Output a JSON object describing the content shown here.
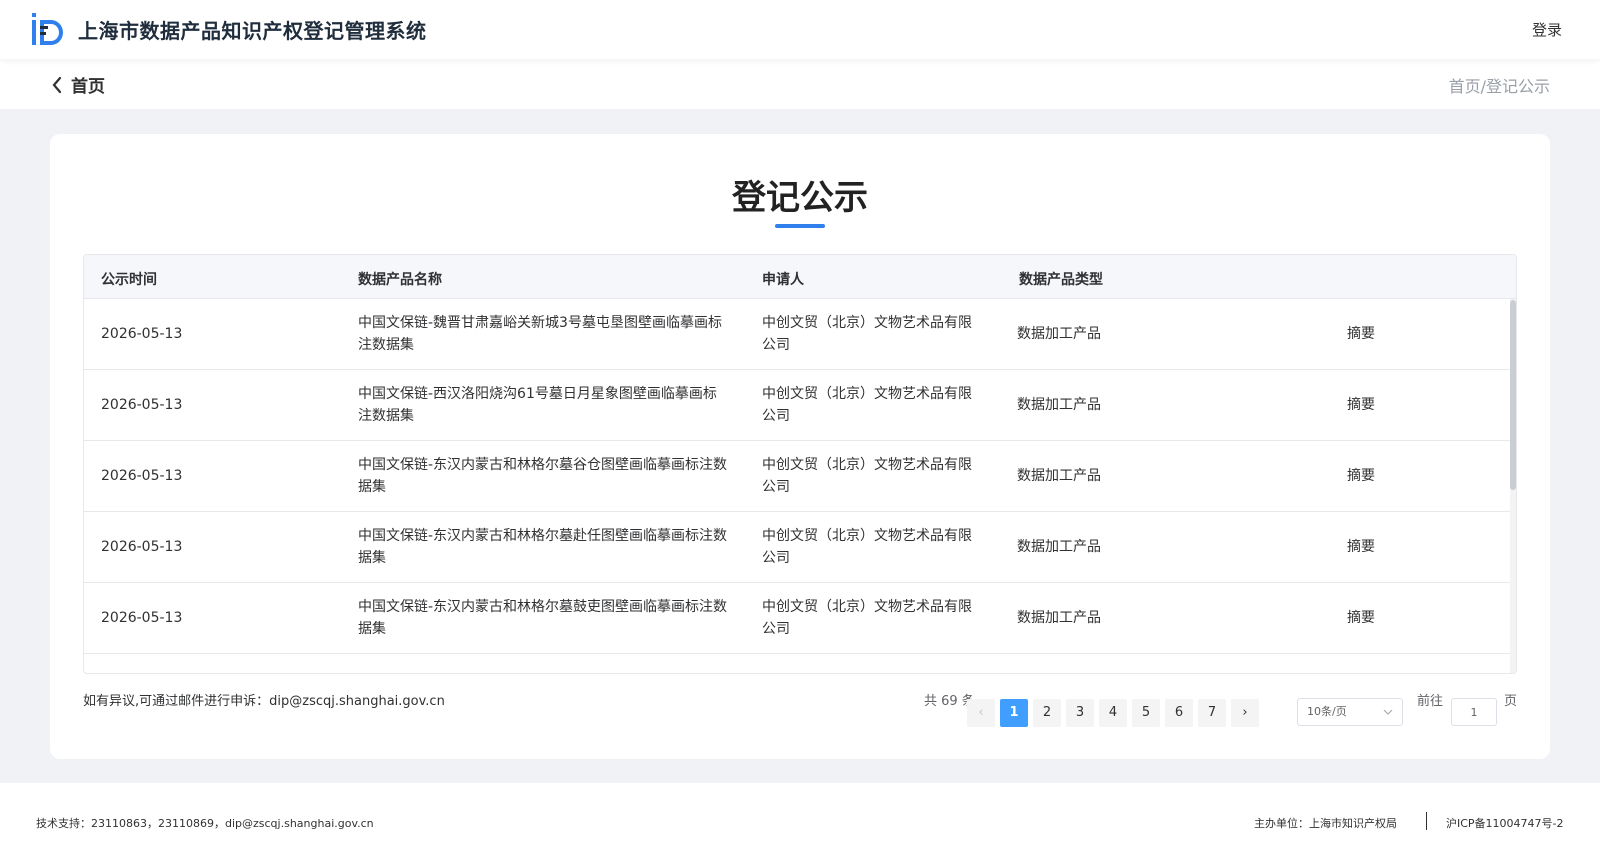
{
  "header": {
    "app_title": "上海市数据产品知识产权登记管理系统",
    "login_label": "登录",
    "brand_color": "#2f80ed"
  },
  "subnav": {
    "back_label": "首页",
    "breadcrumb": "首页/登记公示"
  },
  "main": {
    "title": "登记公示",
    "table": {
      "headers": [
        "公示时间",
        "数据产品名称",
        "申请人",
        "数据产品类型"
      ],
      "rows": [
        {
          "date": "2026-05-13",
          "name": "中国文保链-魏晋甘肃嘉峪关新城3号墓屯垦图壁画临摹画标注数据集",
          "applicant": "中创文贸（北京）文物艺术品有限公司",
          "type": "数据加工产品",
          "action": "摘要"
        },
        {
          "date": "2026-05-13",
          "name": "中国文保链-西汉洛阳烧沟61号墓日月星象图壁画临摹画标注数据集",
          "applicant": "中创文贸（北京）文物艺术品有限公司",
          "type": "数据加工产品",
          "action": "摘要"
        },
        {
          "date": "2026-05-13",
          "name": "中国文保链-东汉内蒙古和林格尔墓谷仓图壁画临摹画标注数据集",
          "applicant": "中创文贸（北京）文物艺术品有限公司",
          "type": "数据加工产品",
          "action": "摘要"
        },
        {
          "date": "2026-05-13",
          "name": "中国文保链-东汉内蒙古和林格尔墓赴任图壁画临摹画标注数据集",
          "applicant": "中创文贸（北京）文物艺术品有限公司",
          "type": "数据加工产品",
          "action": "摘要"
        },
        {
          "date": "2026-05-13",
          "name": "中国文保链-东汉内蒙古和林格尔墓鼓吏图壁画临摹画标注数据集",
          "applicant": "中创文贸（北京）文物艺术品有限公司",
          "type": "数据加工产品",
          "action": "摘要"
        }
      ]
    },
    "complaint_text": "如有异议,可通过邮件进行申诉：dip@zscqj.shanghai.gov.cn",
    "pagination": {
      "total_text": "共 69 条",
      "prev": "‹",
      "next": "›",
      "pages": [
        "1",
        "2",
        "3",
        "4",
        "5",
        "6",
        "7"
      ],
      "current": "1",
      "page_size": "10条/页",
      "goto_label": "前往",
      "goto_value": "1",
      "page_suffix": "页"
    }
  },
  "footer": {
    "tech_support": "技术支持：23110863，23110869，dip@zscqj.shanghai.gov.cn",
    "sponsor": "主办单位：上海市知识产权局",
    "icp": "沪ICP备11004747号-2"
  }
}
